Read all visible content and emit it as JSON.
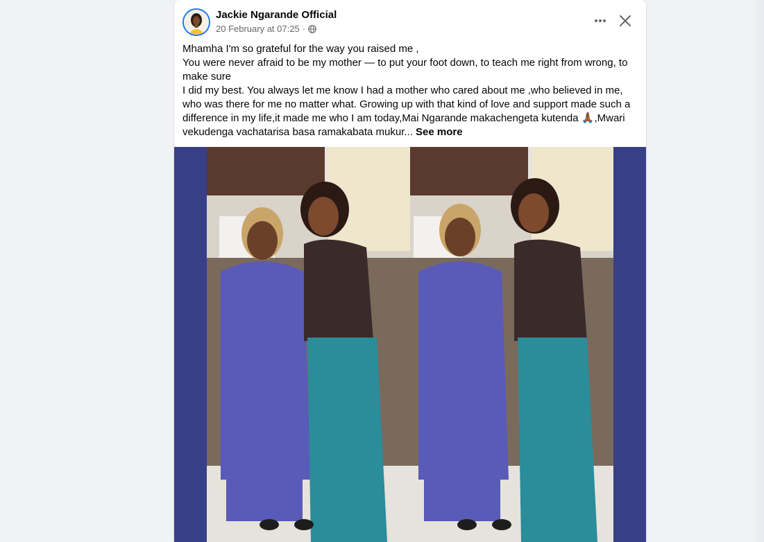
{
  "post": {
    "author": "Jackie Ngarande Official",
    "timestamp": "20 February at 07:25",
    "separator": "·",
    "privacy_icon": "globe-icon",
    "text_lines": [
      "Mhamha I'm so grateful for the way you raised me ,",
      "You were never afraid to be my mother — to put your foot down, to teach me right from wrong, to make sure",
      "I did my best. You always let me know I had a mother who cared about me ,who believed in me, who was there for me no matter what. Growing up with that kind of love and support made such a difference in my life,it made me who I am today,Mai Ngarande makachengeta kutenda"
    ],
    "emoji": "🙏🏾",
    "text_tail": ",Mwari vekudenga vachatarisa basa ramakabata mukur...",
    "see_more": "See more",
    "more_icon": "more-options-icon",
    "close_icon": "close-icon"
  },
  "colors": {
    "page_bg": "#f0f2f5",
    "card_bg": "#ffffff",
    "text": "#050505",
    "muted": "#65676b",
    "media_bg": "#373f87"
  }
}
